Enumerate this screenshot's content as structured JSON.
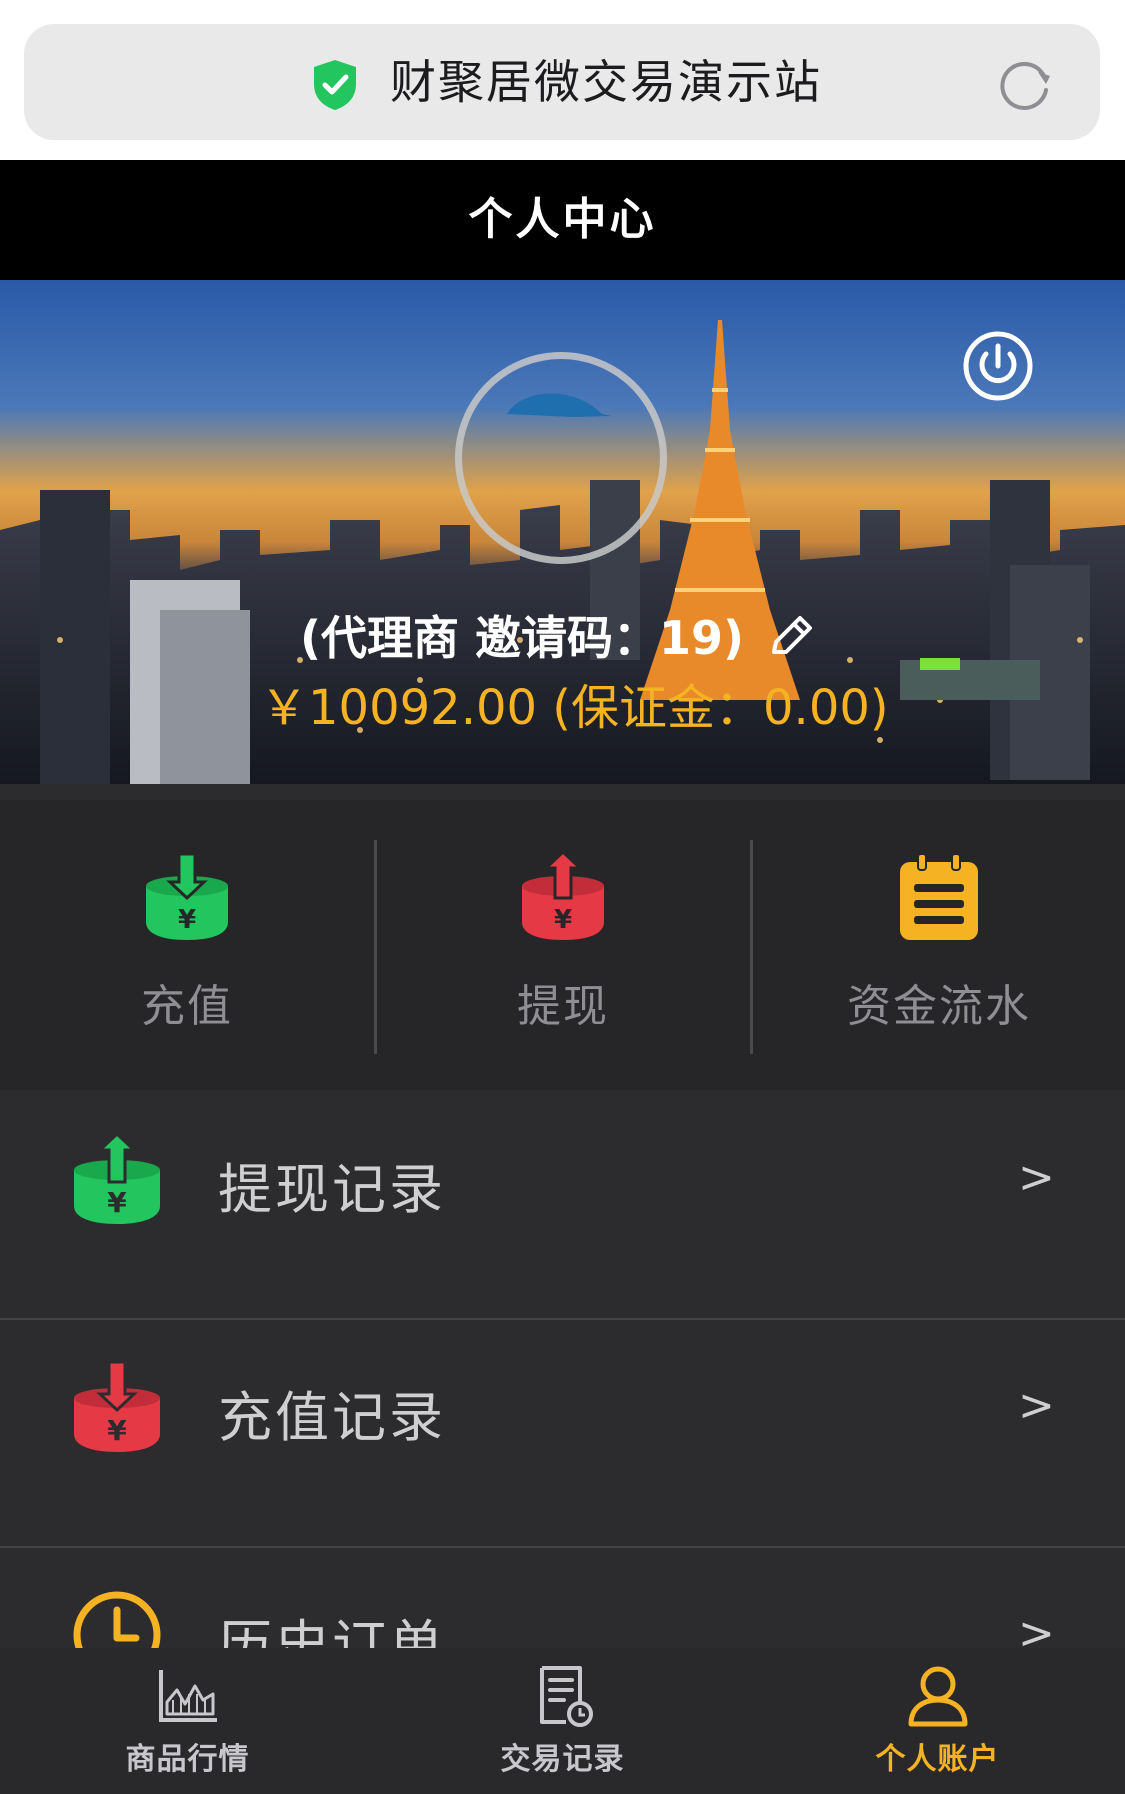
{
  "browser": {
    "url_title": "财聚居微交易演示站"
  },
  "header": {
    "title": "个人中心"
  },
  "profile": {
    "user_line": "(代理商 邀请码：19)",
    "balance_line": "￥10092.00 (保证金：0.00)"
  },
  "quick_actions": [
    {
      "label": "充值",
      "icon": "deposit-icon",
      "color": "#22c55e"
    },
    {
      "label": "提现",
      "icon": "withdraw-icon",
      "color": "#e63946"
    },
    {
      "label": "资金流水",
      "icon": "notepad-icon",
      "color": "#f5b324"
    }
  ],
  "menu": [
    {
      "label": "提现记录",
      "chevron": ">",
      "icon": "withdraw-icon",
      "color": "#22c55e"
    },
    {
      "label": "充值记录",
      "chevron": ">",
      "icon": "deposit-icon",
      "color": "#e63946"
    },
    {
      "label": "历史订单",
      "chevron": ">",
      "icon": "clock-icon",
      "color": "#f5b324"
    }
  ],
  "tabs": [
    {
      "label": "商品行情",
      "icon": "chart-icon",
      "active": false
    },
    {
      "label": "交易记录",
      "icon": "document-icon",
      "active": false
    },
    {
      "label": "个人账户",
      "icon": "user-icon",
      "active": true
    }
  ],
  "colors": {
    "accent": "#f5b324",
    "background": "#2c2c2e",
    "header": "#000000"
  }
}
